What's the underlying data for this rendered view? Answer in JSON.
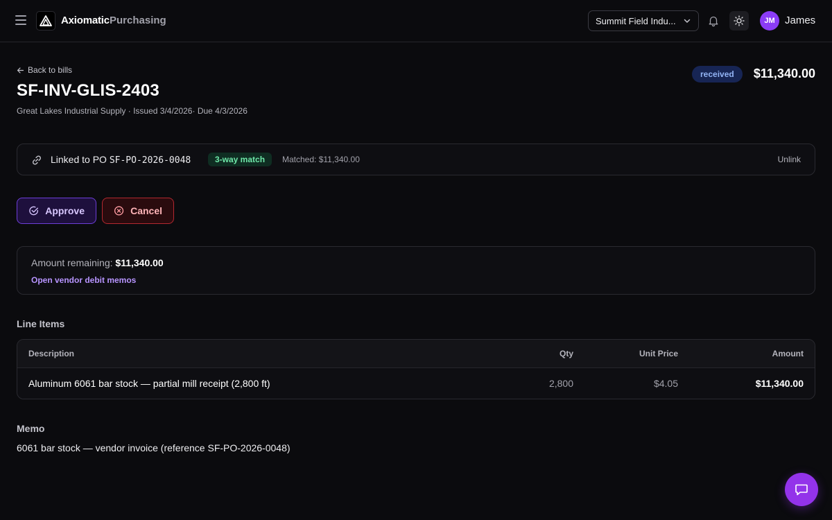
{
  "app": {
    "brand_primary": "Axiomatic",
    "brand_secondary": "Purchasing"
  },
  "header": {
    "org_selector_value": "Summit Field Indu...",
    "user_initials": "JM",
    "user_name": "James"
  },
  "bill": {
    "back_label": "Back to bills",
    "title": "SF-INV-GLIS-2403",
    "subtitle": "Great Lakes Industrial Supply · Issued 3/4/2026· Due 4/3/2026",
    "status": "received",
    "total": "$11,340.00"
  },
  "link": {
    "prefix": "Linked to PO ",
    "po_number": "SF-PO-2026-0048",
    "match_badge": "3-way match",
    "matched_text": "Matched: $11,340.00",
    "unlink_label": "Unlink"
  },
  "actions": {
    "approve_label": "Approve",
    "cancel_label": "Cancel"
  },
  "remaining": {
    "label": "Amount remaining: ",
    "value": "$11,340.00",
    "debit_memos_link": "Open vendor debit memos"
  },
  "line_items": {
    "section_title": "Line Items",
    "columns": {
      "description": "Description",
      "qty": "Qty",
      "unit_price": "Unit Price",
      "amount": "Amount"
    },
    "rows": [
      {
        "description": "Aluminum 6061 bar stock — partial mill receipt (2,800 ft)",
        "qty": "2,800",
        "unit_price": "$4.05",
        "amount": "$11,340.00"
      }
    ]
  },
  "memo": {
    "section_title": "Memo",
    "text": "6061 bar stock — vendor invoice (reference SF-PO-2026-0048)"
  },
  "colors": {
    "background": "#0b0b0e",
    "accent_purple": "#9333ea",
    "status_badge_bg": "#172554",
    "match_badge_bg": "#0f2d22",
    "cancel_red": "#b42830"
  },
  "icons": {
    "menu": "menu-icon",
    "logo": "logo-triangle-icon",
    "org_dropdown": "chevron-down-icon",
    "notifications": "bell-icon",
    "theme": "sun-icon",
    "back": "arrow-left-icon",
    "link": "link-icon",
    "approve": "check-circle-icon",
    "cancel": "x-circle-icon",
    "chat": "chat-bubble-icon"
  }
}
